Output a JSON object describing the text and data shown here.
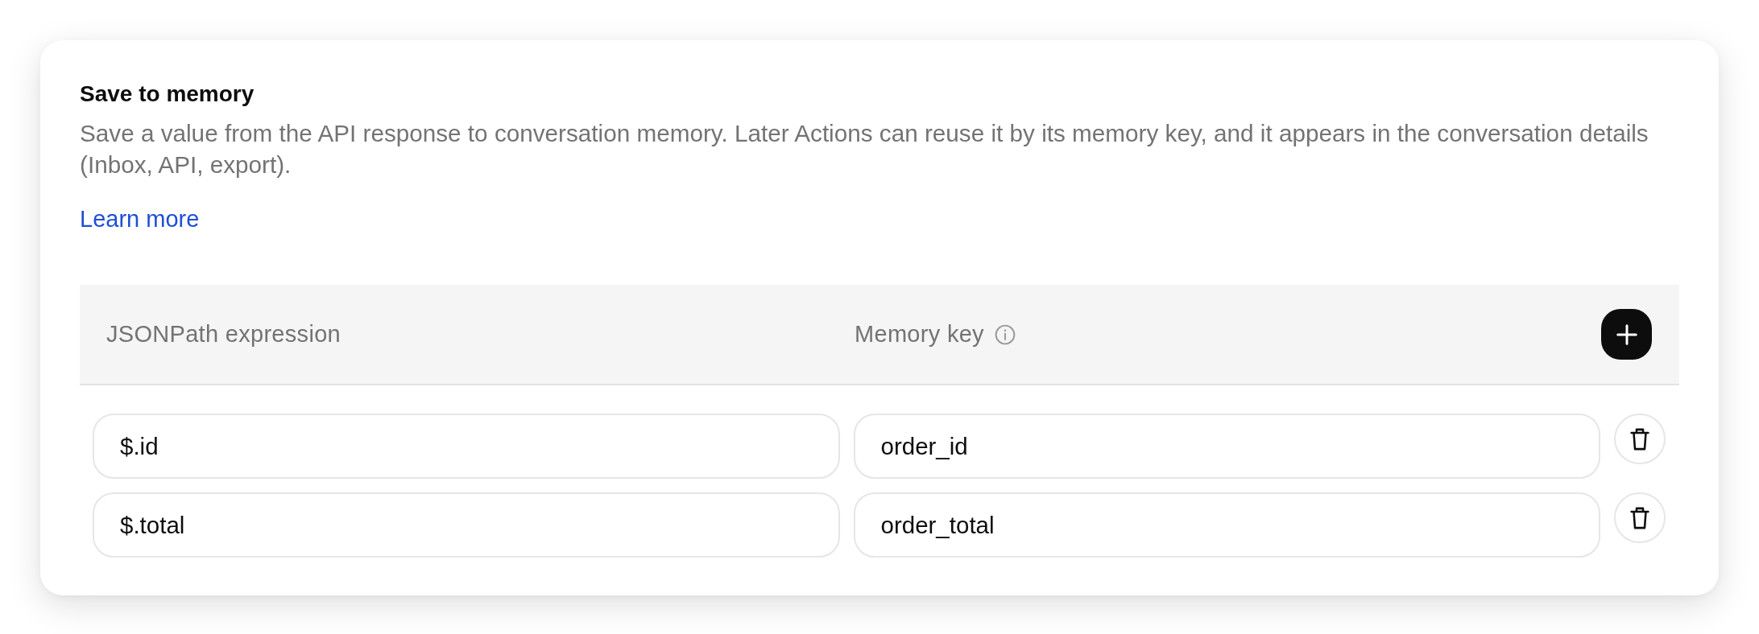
{
  "section": {
    "title": "Save to memory",
    "description": "Save a value from the API response to conversation memory. Later Actions can reuse it by its memory key, and it appears in the conversation details (Inbox, API, export).",
    "link": "Learn more"
  },
  "table": {
    "columns": [
      {
        "label": "JSONPath expression",
        "info": false
      },
      {
        "label": "Memory key",
        "info": true
      }
    ],
    "rows": [
      {
        "expression": "$.id",
        "memory_key": "order_id"
      },
      {
        "expression": "$.total",
        "memory_key": "order_total"
      }
    ]
  }
}
